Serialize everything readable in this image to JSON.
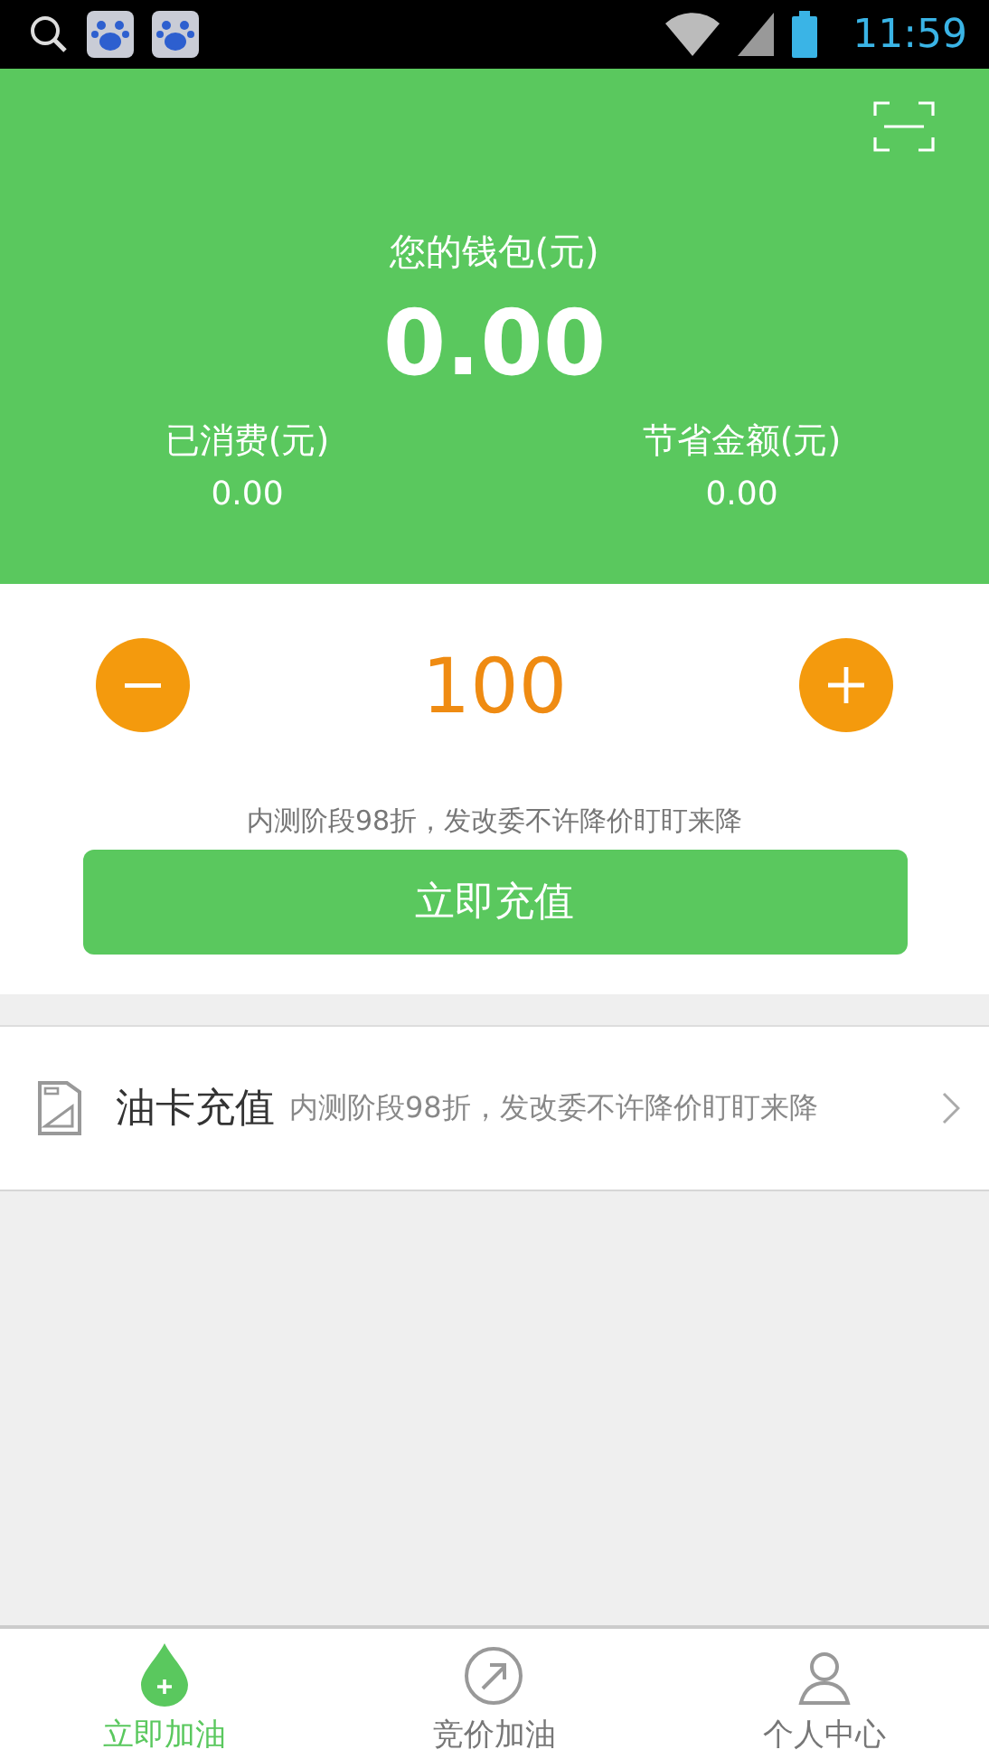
{
  "status_bar": {
    "time": "11:59"
  },
  "wallet": {
    "title": "您的钱包(元)",
    "amount": "0.00",
    "stats": [
      {
        "label": "已消费(元)",
        "value": "0.00"
      },
      {
        "label": "节省金额(元)",
        "value": "0.00"
      }
    ]
  },
  "recharge": {
    "amount": "100",
    "note": "内测阶段98折，发改委不许降价盯盯来降",
    "button": "立即充值"
  },
  "list": [
    {
      "title": "油卡充值",
      "subtitle": "内测阶段98折，发改委不许降价盯盯来降"
    }
  ],
  "tabs": [
    {
      "kind": "drop",
      "label": "立即加油",
      "selected": true
    },
    {
      "kind": "arrow",
      "label": "竞价加油",
      "selected": false
    },
    {
      "kind": "person",
      "label": "个人中心",
      "selected": false
    }
  ]
}
